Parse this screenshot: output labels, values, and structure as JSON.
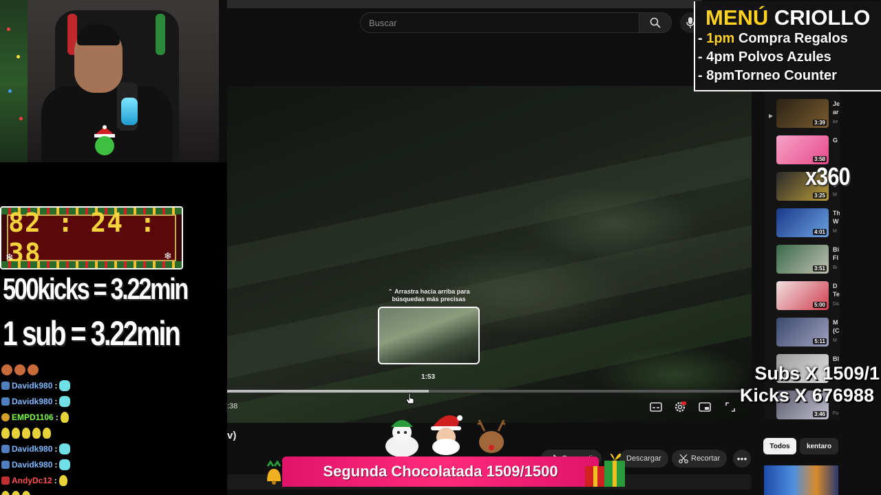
{
  "youtube": {
    "search_placeholder": "Buscar",
    "preview_hint": "Arrastra hacia arriba para búsquedas más precisas",
    "preview_time": "1:53",
    "current_time_fragment": ":38",
    "progress_fraction": 0.385,
    "title_fragment": "v)",
    "actions": {
      "share": "Compartir",
      "download": "Descargar",
      "clip": "Recortar"
    },
    "chips": [
      "Todos",
      "kentaro"
    ],
    "recommendations": [
      {
        "duration": "3:39",
        "title": "Je",
        "title2": "ar",
        "channel": "ke",
        "colors": [
          "#2b2316",
          "#7a5a30"
        ]
      },
      {
        "duration": "3:58",
        "title": "G",
        "title2": "",
        "channel": "",
        "colors": [
          "#f5a3c7",
          "#e84a8a"
        ]
      },
      {
        "duration": "3:25",
        "title": "",
        "title2": "V",
        "channel": "M",
        "colors": [
          "#2a2a2a",
          "#b89a3a"
        ]
      },
      {
        "duration": "4:01",
        "title": "Th",
        "title2": "W",
        "channel": "M",
        "colors": [
          "#1a3a8a",
          "#6aa0e0"
        ]
      },
      {
        "duration": "3:51",
        "title": "Bi",
        "title2": "Fl",
        "channel": "Bi",
        "colors": [
          "#3a6a4a",
          "#c0c0b0"
        ]
      },
      {
        "duration": "5:00",
        "title": "D",
        "title2": "Te",
        "channel": "Da",
        "colors": [
          "#f0e0e0",
          "#d04050"
        ]
      },
      {
        "duration": "5:11",
        "title": "M",
        "title2": "(C",
        "channel": "M",
        "colors": [
          "#3a4a6a",
          "#a0a0c0"
        ]
      },
      {
        "duration": "",
        "title": "Bl",
        "title2": "",
        "channel": "",
        "colors": [
          "#9a9a9a",
          "#e0e0e0"
        ]
      },
      {
        "duration": "3:46",
        "title": "",
        "title2": "",
        "channel": "Fu",
        "colors": [
          "#5a5a6a",
          "#c0c0d0"
        ]
      }
    ]
  },
  "overlay": {
    "menu_title_a": "MENÚ",
    "menu_title_b": "CRIOLLO",
    "menu_items": [
      {
        "prefix": "- ",
        "time": "1pm",
        "text": " Compra Regalos"
      },
      {
        "prefix": "- ",
        "time": "",
        "text": "4pm Polvos Azules"
      },
      {
        "prefix": "- ",
        "time": "",
        "text": "8pmTorneo Counter"
      }
    ],
    "multiplier": "x360",
    "subs_line": "Subs X 1509/1",
    "kicks_line": "Kicks X 676988",
    "timer": "82 : 24 : 38",
    "rate_kicks": "500kicks = 3.22min",
    "rate_sub": "1 sub = 3.22min",
    "banner": "Segunda Chocolatada 1509/1500"
  },
  "chat": [
    {
      "user": "",
      "sep": "",
      "emotes": [
        "face",
        "face",
        "face"
      ],
      "badge": ""
    },
    {
      "user": "Davidk980",
      "sep": " :",
      "emotes": [
        "cyan"
      ],
      "badge": "blue",
      "color": "blue"
    },
    {
      "user": "Davidk980",
      "sep": " :",
      "emotes": [
        "cyan"
      ],
      "badge": "blue",
      "color": "blue"
    },
    {
      "user": "EMPD1106",
      "sep": " :",
      "emotes": [
        "yellow"
      ],
      "badge": "gold",
      "color": "green"
    },
    {
      "user": "",
      "sep": "",
      "emotes": [
        "yellow",
        "yellow",
        "yellow",
        "yellow",
        "yellow"
      ],
      "badge": ""
    },
    {
      "user": "Davidk980",
      "sep": " :",
      "emotes": [
        "cyan"
      ],
      "badge": "blue",
      "color": "blue"
    },
    {
      "user": "Davidk980",
      "sep": " :",
      "emotes": [
        "cyan"
      ],
      "badge": "blue",
      "color": "blue"
    },
    {
      "user": "AndyDc12",
      "sep": " :",
      "emotes": [
        "yellow"
      ],
      "badge": "red",
      "color": "red"
    },
    {
      "user": "",
      "sep": "",
      "emotes": [
        "yellow",
        "yellow",
        "yellow"
      ],
      "badge": ""
    }
  ]
}
